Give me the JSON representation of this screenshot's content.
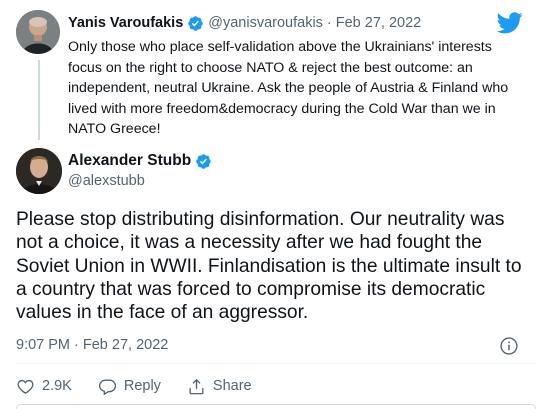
{
  "quoted_tweet": {
    "author_name": "Yanis Varoufakis",
    "author_handle": "@yanisvaroufakis",
    "separator": "·",
    "date": "Feb 27, 2022",
    "text": "Only those who place self-validation above the Ukrainians' interests focus on the right to choose NATO & reject the best outcome: an independent, neutral Ukraine. Ask the people of Austria & Finland who lived with more freedom&democracy during the Cold War than we in NATO Greece!",
    "verified_icon": "verified-badge-icon",
    "avatar_icon": "avatar-photo"
  },
  "main_tweet": {
    "author_name": "Alexander Stubb",
    "author_handle": "@alexstubb",
    "text": "Please stop distributing disinformation. Our neutrality was not a choice, it was a necessity after we had fought the Soviet Union in WWII. Finlandisation is the ultimate insult to a country that was forced to compromise its democratic values in the face of an aggressor.",
    "timestamp": "9:07 PM · Feb 27, 2022",
    "verified_icon": "verified-badge-icon",
    "avatar_icon": "avatar-photo"
  },
  "actions": {
    "like_count": "2.9K",
    "reply_label": "Reply",
    "share_label": "Share"
  },
  "colors": {
    "twitter_blue": "#1d9bf0",
    "text_primary": "#0f1419",
    "text_secondary": "#536471"
  },
  "icons": {
    "logo": "twitter-bird-icon",
    "info": "info-icon",
    "like": "heart-icon",
    "reply": "reply-bubble-icon",
    "share": "share-upload-icon"
  }
}
